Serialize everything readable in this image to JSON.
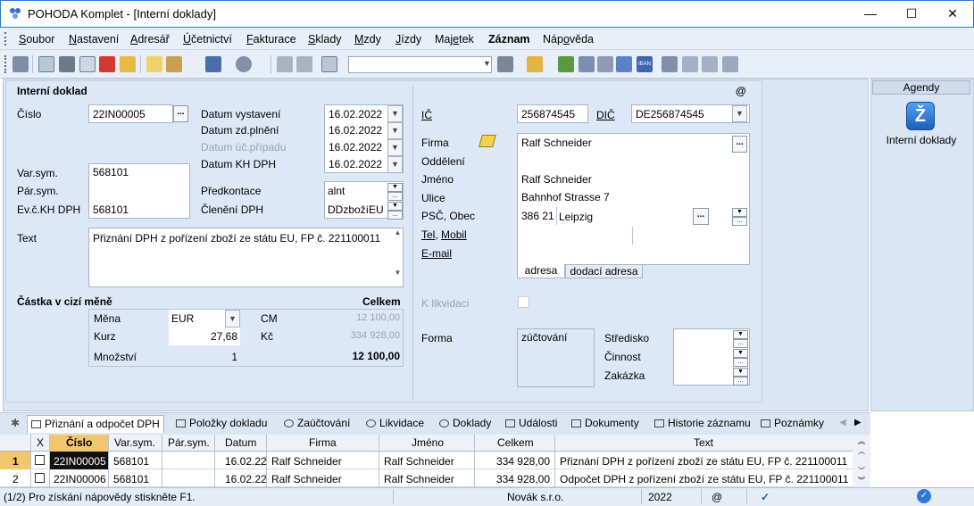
{
  "window": {
    "title": "POHODA Komplet - [Interní doklady]",
    "minimize": "—",
    "maximize": "☐",
    "close": "✕"
  },
  "menu": [
    {
      "label": "Soubor",
      "u": "S",
      "rest": "oubor"
    },
    {
      "label": "Nastavení",
      "u": "N",
      "rest": "astavení"
    },
    {
      "label": "Adresář",
      "u": "A",
      "rest": "dresář"
    },
    {
      "label": "Účetnictví",
      "u": "Ú",
      "rest": "četnictví"
    },
    {
      "label": "Fakturace",
      "u": "F",
      "rest": "akturace"
    },
    {
      "label": "Sklady",
      "u": "S",
      "rest": "klady"
    },
    {
      "label": "Mzdy",
      "u": "M",
      "rest": "zdy"
    },
    {
      "label": "Jízdy",
      "u": "J",
      "rest": "ízdy"
    },
    {
      "label": "Majetek",
      "pre": "Maj",
      "u": "e",
      "rest": "tek"
    },
    {
      "label": "Záznam",
      "bold": true
    },
    {
      "label": "Nápověda",
      "pre": "Náp",
      "u": "o",
      "rest": "věda"
    }
  ],
  "form": {
    "section_title": "Interní doklad",
    "at_sign": "@",
    "cislo_label": "Číslo",
    "cislo": "22IN00005",
    "varsym_label": "Var.sym.",
    "varsym": "568101",
    "parsym_label": "Pár.sym.",
    "parsym": "",
    "evkh_label": "Ev.č.KH DPH",
    "evkh": "568101",
    "datum_vystaveni_label": "Datum vystavení",
    "datum_vystaveni": "16.02.2022",
    "datum_zdplneni_label": "Datum zd.plnění",
    "datum_zdplneni": "16.02.2022",
    "datum_ucpripadu_label": "Datum úč.případu",
    "datum_ucpripadu": "16.02.2022",
    "datum_kh_label": "Datum KH DPH",
    "datum_kh": "16.02.2022",
    "predkontace_label": "Předkontace",
    "predkontace": "alnt",
    "cleneni_label": "Členění DPH",
    "cleneni": "DDzbožíEU",
    "text_label": "Text",
    "text": "Přiznání DPH z pořízení zboží ze státu EU, FP č.  221100011",
    "ic_label": "IČ",
    "ic": "256874545",
    "dic_label": "DIČ",
    "dic": "DE256874545",
    "firma_label": "Firma",
    "firma": "Ralf Schneider",
    "oddeleni_label": "Oddělení",
    "jmeno_label": "Jméno",
    "jmeno": "Ralf Schneider",
    "ulice_label": "Ulice",
    "ulice": "Bahnhof Strasse 7",
    "psc_label": "PSČ, Obec",
    "psc": "386 21",
    "obec": "Leipzig",
    "tel_label": "Tel",
    "mobil_label": "Mobil",
    "comma": ",",
    "email_label": "E-mail",
    "addr_tab1": "adresa",
    "addr_tab2": "dodací adresa",
    "likvidace_label": "K likvidaci",
    "forma_label": "Forma",
    "forma": "zúčtování",
    "stredisko_label": "Středisko",
    "cinnost_label": "Činnost",
    "zakazka_label": "Zakázka",
    "cm_title": "Částka v cizí měně",
    "celkem_title": "Celkem",
    "mena_label": "Měna",
    "mena": "EUR",
    "kurz_label": "Kurz",
    "kurz": "27,68",
    "mnozstvi_label": "Množství",
    "mnozstvi": "1",
    "cm_label": "CM",
    "cm_value": "12 100,00",
    "kc_label": "Kč",
    "kc_value": "334 928,00",
    "total": "12 100,00"
  },
  "agendy": {
    "header": "Agendy",
    "item": "Interní doklady",
    "icon_glyph": "Ž"
  },
  "tabs": [
    "✱",
    "Přiznání a odpočet DPH",
    "Položky dokladu",
    "Zaúčtování",
    "Likvidace",
    "Doklady",
    "Události",
    "Dokumenty",
    "Historie záznamu",
    "Poznámky"
  ],
  "grid": {
    "headers": [
      "X",
      "Číslo",
      "Var.sym.",
      "Pár.sym.",
      "Datum",
      "Firma",
      "Jméno",
      "Celkem",
      "Text"
    ],
    "rows": [
      {
        "n": "1",
        "cislo": "22IN00005",
        "varsym": "568101",
        "parsym": "",
        "datum": "16.02.22",
        "firma": "Ralf Schneider",
        "jmeno": "Ralf Schneider",
        "celkem": "334 928,00",
        "text": "Přiznání DPH z pořízení zboží ze státu EU, FP č.  221100011"
      },
      {
        "n": "2",
        "cislo": "22IN00006",
        "varsym": "568101",
        "parsym": "",
        "datum": "16.02.22",
        "firma": "Ralf Schneider",
        "jmeno": "Ralf Schneider",
        "celkem": "334 928,00",
        "text": "Odpočet DPH z pořízení zboží ze státu EU, FP č.  221100011"
      }
    ]
  },
  "status": {
    "help": "(1/2) Pro získání nápovědy stiskněte F1.",
    "company": "Novák s.r.o.",
    "year": "2022",
    "at": "@",
    "check": "✓"
  },
  "colors": {
    "accent": "#2b7bd6",
    "panel": "#dce8f7",
    "selected_row": "#111111"
  }
}
